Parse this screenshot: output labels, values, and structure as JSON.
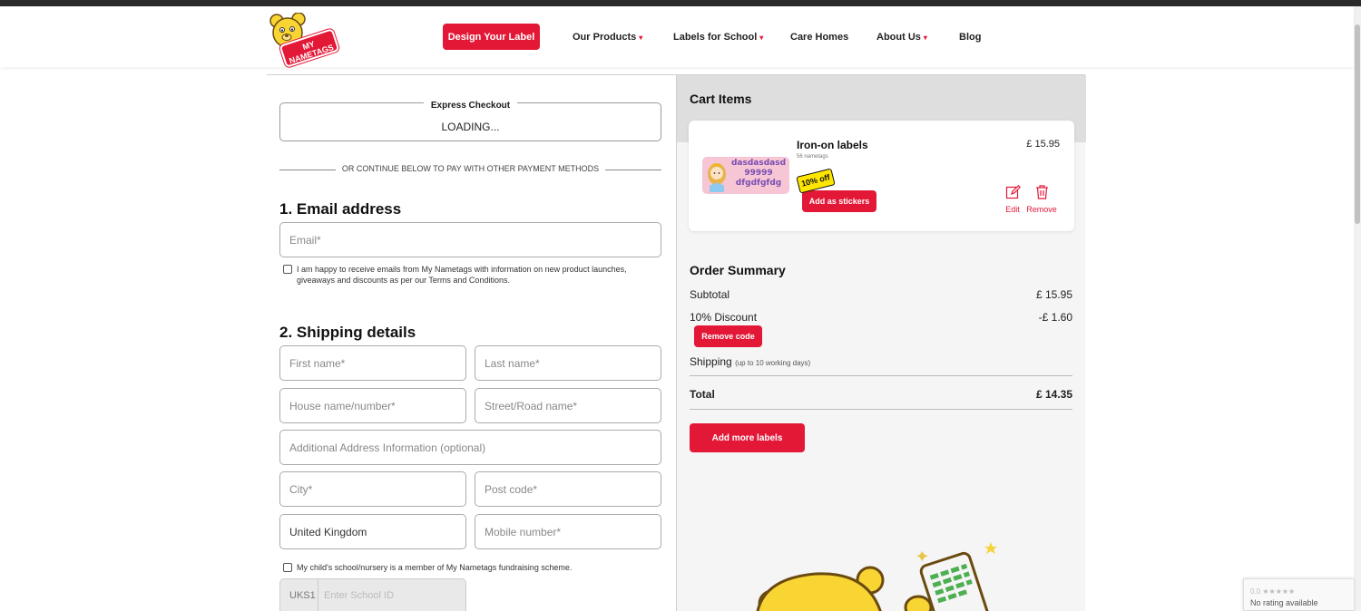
{
  "header": {
    "logo_text": "MY NAMETAGS",
    "design_label": "Design Your Label",
    "nav": [
      {
        "label": "Our Products",
        "has_menu": true
      },
      {
        "label": "Labels for School",
        "has_menu": true
      },
      {
        "label": "Care Homes",
        "has_menu": false
      },
      {
        "label": "About Us",
        "has_menu": true
      },
      {
        "label": "Blog",
        "has_menu": false
      }
    ]
  },
  "checkout": {
    "express_title": "Express Checkout",
    "express_status": "LOADING...",
    "divider_text": "OR CONTINUE BELOW TO PAY WITH OTHER PAYMENT METHODS",
    "email_section": "1. Email address",
    "email_placeholder": "Email*",
    "marketing_line1": "I am happy to receive emails from My Nametags with information on new product launches,",
    "marketing_line2": "giveaways and discounts as per our Terms and Conditions.",
    "shipping_section": "2. Shipping details",
    "first_name_placeholder": "First name*",
    "last_name_placeholder": "Last name*",
    "house_placeholder": "House name/number*",
    "street_placeholder": "Street/Road name*",
    "additional_placeholder": "Additional Address Information (optional)",
    "city_placeholder": "City*",
    "postcode_placeholder": "Post code*",
    "country_value": "United Kingdom",
    "mobile_placeholder": "Mobile number*",
    "school_check_text": "My child's school/nursery is a member of My Nametags fundraising scheme.",
    "school_prefix": "UKS1",
    "school_placeholder": "Enter School ID"
  },
  "cart": {
    "title": "Cart Items",
    "item": {
      "name": "Iron-on labels",
      "quantity_text": "56 nametags",
      "price": "£ 15.95",
      "label_lines": [
        "dasdasdasd",
        "99999",
        "dfgdfgfdg"
      ],
      "discount_badge": "10% off",
      "stickers_label": "Add as stickers",
      "edit_label": "Edit",
      "remove_label": "Remove"
    }
  },
  "summary": {
    "title": "Order Summary",
    "subtotal_label": "Subtotal",
    "subtotal_value": "£ 15.95",
    "discount_label": "10% Discount",
    "discount_value": "-£ 1.60",
    "remove_code_label": "Remove code",
    "shipping_label": "Shipping",
    "shipping_note": "(up to 10 working days)",
    "total_label": "Total",
    "total_value": "£ 14.35",
    "add_more_label": "Add more labels"
  },
  "recaptcha": {
    "rating": "0.0 ★★★★★",
    "status": "No rating available"
  },
  "colors": {
    "brand_red": "#e31837",
    "bear_yellow": "#f9d534"
  }
}
